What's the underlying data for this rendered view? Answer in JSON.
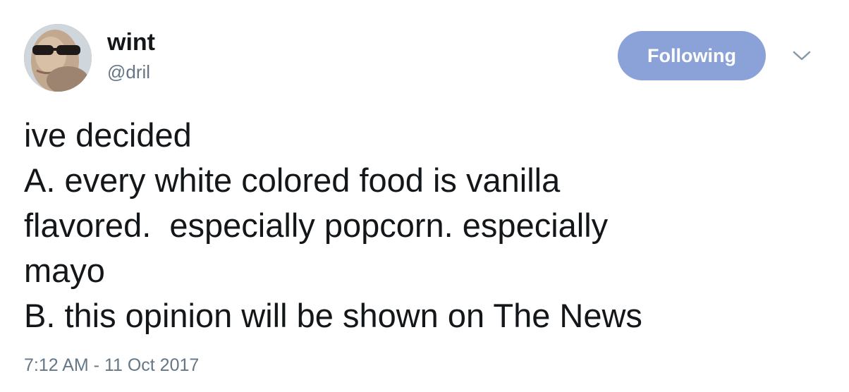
{
  "author": {
    "display_name": "wint",
    "handle": "@dril",
    "avatar_icon": "profile-photo"
  },
  "actions": {
    "follow_label": "Following",
    "follow_color": "#8aa2d8",
    "menu_icon": "chevron-down-icon"
  },
  "tweet": {
    "lines": [
      "ive decided",
      "A. every white colored food is vanilla",
      "flavored.  especially popcorn. especially",
      "mayo",
      "B. this opinion will be shown on The News"
    ],
    "timestamp": "7:12 AM - 11 Oct 2017"
  }
}
